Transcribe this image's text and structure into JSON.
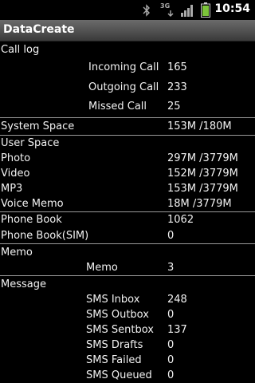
{
  "status_bar": {
    "time": "10:54",
    "network_label": "3G",
    "icons": [
      "bluetooth-icon",
      "3g-icon",
      "signal-icon",
      "battery-icon"
    ]
  },
  "app": {
    "title": "DataCreate"
  },
  "call_log": {
    "heading": "Call log",
    "rows": [
      {
        "label": "Incoming Call",
        "value": "165"
      },
      {
        "label": "Outgoing Call",
        "value": "233"
      },
      {
        "label": "Missed Call",
        "value": "25"
      }
    ]
  },
  "system_space": {
    "label": "System Space",
    "value": "153M /180M"
  },
  "user_space": {
    "heading": "User Space",
    "rows": [
      {
        "label": "Photo",
        "value": "297M /3779M"
      },
      {
        "label": "Video",
        "value": "152M /3779M"
      },
      {
        "label": "MP3",
        "value": "153M /3779M"
      },
      {
        "label": "Voice Memo",
        "value": "18M /3779M"
      }
    ]
  },
  "phone_book": {
    "rows": [
      {
        "label": "Phone Book",
        "value": "1062"
      },
      {
        "label": "Phone Book(SIM)",
        "value": "0"
      }
    ]
  },
  "memo": {
    "heading": "Memo",
    "label": "Memo",
    "value": "3"
  },
  "message": {
    "heading": "Message",
    "rows": [
      {
        "label": "SMS Inbox",
        "value": "248"
      },
      {
        "label": "SMS Outbox",
        "value": "0"
      },
      {
        "label": "SMS Sentbox",
        "value": "137"
      },
      {
        "label": "SMS Drafts",
        "value": "0"
      },
      {
        "label": "SMS Failed",
        "value": "0"
      },
      {
        "label": "SMS Queued",
        "value": "0"
      }
    ]
  }
}
